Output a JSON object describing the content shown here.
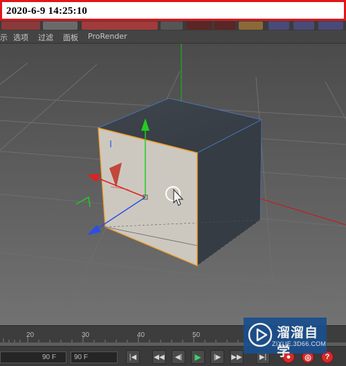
{
  "timestamp": "2020-6-9 14:25:10",
  "menu": {
    "items": [
      {
        "label": "示",
        "name": "menu-item-partial"
      },
      {
        "label": "选项",
        "name": "menu-item-options"
      },
      {
        "label": "过滤",
        "name": "menu-item-filter"
      },
      {
        "label": "面板",
        "name": "menu-item-panel"
      },
      {
        "label": "ProRender",
        "name": "menu-item-prorender"
      }
    ]
  },
  "timeline": {
    "ticks": [
      "20",
      "30",
      "40",
      "50"
    ]
  },
  "transport": {
    "frame_field": "90 F",
    "end_field": "90 F"
  },
  "watermark": {
    "title": "溜溜自学",
    "url": "ZIXUE.3D66.COM"
  },
  "colors": {
    "stamp_border": "#e0161b",
    "axis_x": "#e02020",
    "axis_y": "#22cc22",
    "axis_z": "#2a4fe6",
    "selection": "#f0a030",
    "cube_front": "#cdc8bf",
    "cube_top": "#3c4249",
    "cube_side": "#343a41"
  }
}
